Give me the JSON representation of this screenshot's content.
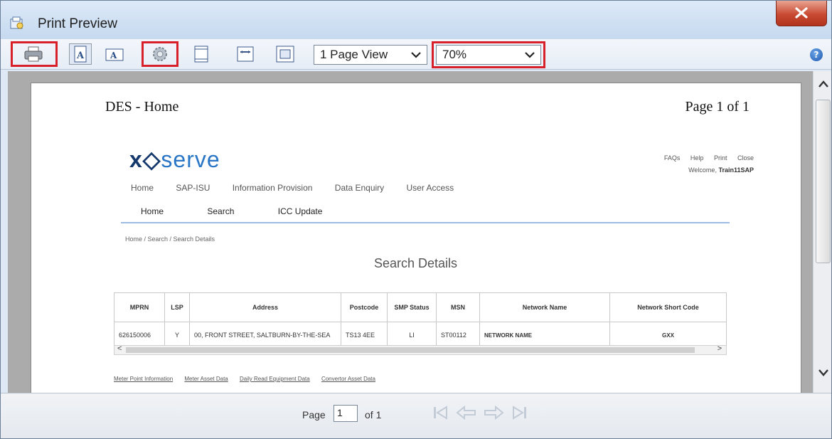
{
  "window": {
    "title": "Print Preview",
    "close_label": "X"
  },
  "toolbar": {
    "buttons": [
      {
        "name": "print-icon"
      },
      {
        "name": "portrait-icon"
      },
      {
        "name": "landscape-icon"
      },
      {
        "name": "page-setup-icon"
      },
      {
        "name": "header-footer-icon"
      },
      {
        "name": "full-width-icon"
      },
      {
        "name": "shrink-to-fit-icon"
      }
    ],
    "view_mode": "1 Page View",
    "zoom": "70%",
    "help_label": "?",
    "highlight_color": "#d8202a"
  },
  "page": {
    "header_left": "DES - Home",
    "header_right": "Page 1 of 1",
    "logo_prefix": "x◇",
    "logo_text": "serve",
    "top_links": [
      "FAQs",
      "Help",
      "Print",
      "Close"
    ],
    "welcome_prefix": "Welcome,",
    "welcome_user": "Train11SAP",
    "nav_primary": [
      "Home",
      "SAP-ISU",
      "Information Provision",
      "Data Enquiry",
      "User Access"
    ],
    "nav_secondary": [
      "Home",
      "Search",
      "ICC Update"
    ],
    "breadcrumb": "Home / Search / Search Details",
    "section_title": "Search Details",
    "table": {
      "headers": [
        "MPRN",
        "LSP",
        "Address",
        "Postcode",
        "SMP Status",
        "MSN",
        "Network Name",
        "Network Short Code"
      ],
      "rows": [
        [
          "626150006",
          "Y",
          "00, FRONT STREET, SALTBURN-BY-THE-SEA",
          "TS13 4EE",
          "LI",
          "ST00112",
          "NETWORK NAME",
          "GXX"
        ]
      ]
    },
    "bottom_links": [
      "Meter Point Information",
      "Meter Asset Data",
      "Daily Read Equipment Data",
      "Convertor Asset Data"
    ]
  },
  "status": {
    "page_label": "Page",
    "page_value": "1",
    "of_label": "of 1"
  }
}
